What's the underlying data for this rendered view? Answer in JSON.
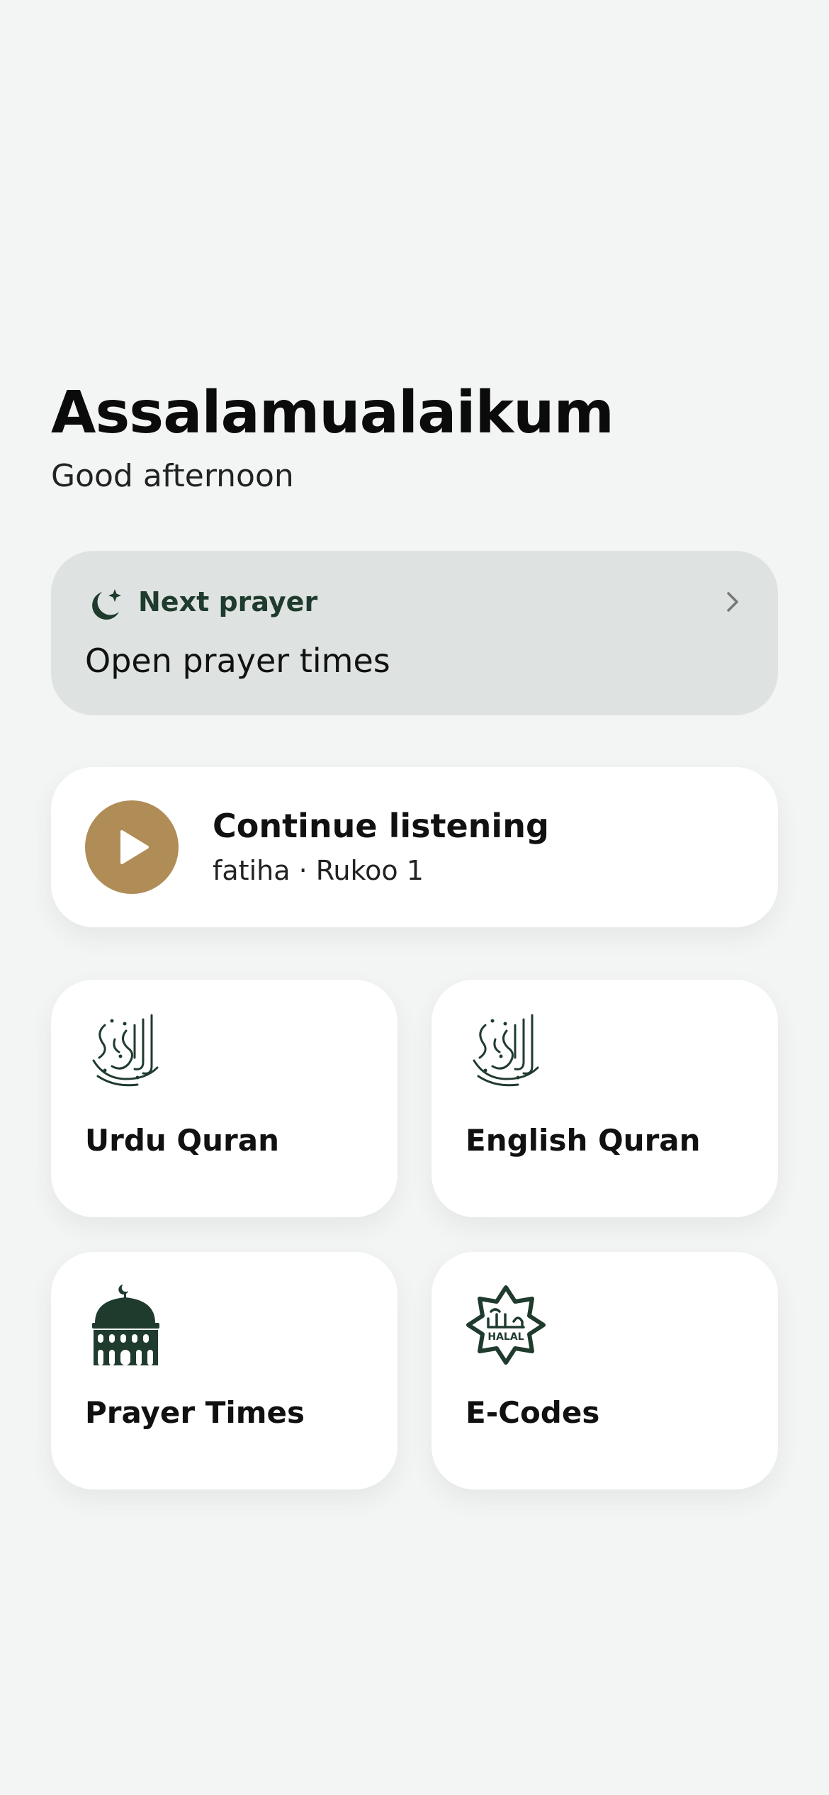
{
  "header": {
    "title": "Assalamualaikum",
    "subtitle": "Good afternoon"
  },
  "prayer_card": {
    "icon": "moon-star-icon",
    "label": "Next prayer",
    "action": "Open prayer times",
    "chevron": "chevron-right-icon"
  },
  "listening_card": {
    "icon": "play-icon",
    "title": "Continue listening",
    "subtitle": "fatiha · Rukoo 1"
  },
  "tiles": [
    {
      "label": "Urdu Quran",
      "icon": "quran-calligraphy-icon"
    },
    {
      "label": "English Quran",
      "icon": "quran-calligraphy-icon"
    },
    {
      "label": "Prayer Times",
      "icon": "mosque-icon"
    },
    {
      "label": "E-Codes",
      "icon": "halal-badge-icon",
      "badge_text": "HALAL"
    }
  ],
  "colors": {
    "background": "#f3f5f4",
    "accent_green": "#1f3b2e",
    "play_gold": "#b08d57",
    "prayer_card_bg": "#dee3e1",
    "card_bg": "#ffffff"
  }
}
